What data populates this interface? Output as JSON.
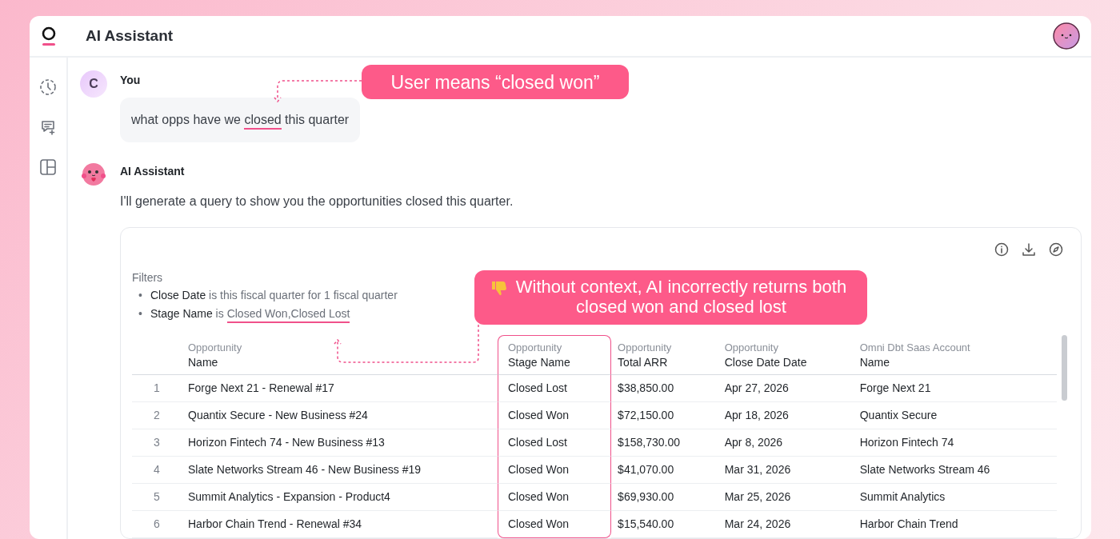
{
  "header": {
    "title": "AI Assistant"
  },
  "messages": [
    {
      "kind": "user",
      "author": "You",
      "avatar_letter": "C",
      "before": "what opps have we ",
      "highlighted": "closed",
      "after": " this quarter"
    },
    {
      "kind": "assistant",
      "author": "AI Assistant",
      "text": "I'll generate a query to show you the opportunities closed this quarter."
    }
  ],
  "result": {
    "filters_title": "Filters",
    "filters": [
      {
        "bullet": "•",
        "field": "Close Date",
        "operator": "is",
        "value": "this fiscal quarter for 1 fiscal quarter",
        "highlighted": false
      },
      {
        "bullet": "•",
        "field": "Stage Name",
        "operator": "is",
        "value": "Closed Won,Closed Lost",
        "highlighted": true
      }
    ],
    "columns": [
      {
        "group": "Opportunity",
        "name": "Name",
        "highlighted": false
      },
      {
        "group": "Opportunity",
        "name": "Stage Name",
        "highlighted": true
      },
      {
        "group": "Opportunity",
        "name": "Total ARR",
        "highlighted": false
      },
      {
        "group": "Opportunity",
        "name": "Close Date Date",
        "highlighted": false
      },
      {
        "group": "Omni Dbt Saas Account",
        "name": "Name",
        "highlighted": false
      }
    ],
    "rows": [
      {
        "index": "1",
        "cells": [
          "Forge Next 21 - Renewal #17",
          "Closed Lost",
          "$38,850.00",
          "Apr 27, 2026",
          "Forge Next 21"
        ]
      },
      {
        "index": "2",
        "cells": [
          "Quantix Secure - New Business #24",
          "Closed Won",
          "$72,150.00",
          "Apr 18, 2026",
          "Quantix Secure"
        ]
      },
      {
        "index": "3",
        "cells": [
          "Horizon Fintech 74 - New Business #13",
          "Closed Lost",
          "$158,730.00",
          "Apr 8, 2026",
          "Horizon Fintech 74"
        ]
      },
      {
        "index": "4",
        "cells": [
          "Slate Networks Stream 46 - New Business #19",
          "Closed Won",
          "$41,070.00",
          "Mar 31, 2026",
          "Slate Networks Stream 46"
        ]
      },
      {
        "index": "5",
        "cells": [
          "Summit Analytics - Expansion - Product4",
          "Closed Won",
          "$69,930.00",
          "Mar 25, 2026",
          "Summit Analytics"
        ]
      },
      {
        "index": "6",
        "cells": [
          "Harbor Chain Trend - Renewal #34",
          "Closed Won",
          "$15,540.00",
          "Mar 24, 2026",
          "Harbor Chain Trend"
        ]
      }
    ]
  },
  "annotations": [
    {
      "kind": "plain",
      "text": "User means “closed won”"
    },
    {
      "kind": "negative",
      "text": "Without context, AI incorrectly returns both closed won and closed lost"
    }
  ]
}
